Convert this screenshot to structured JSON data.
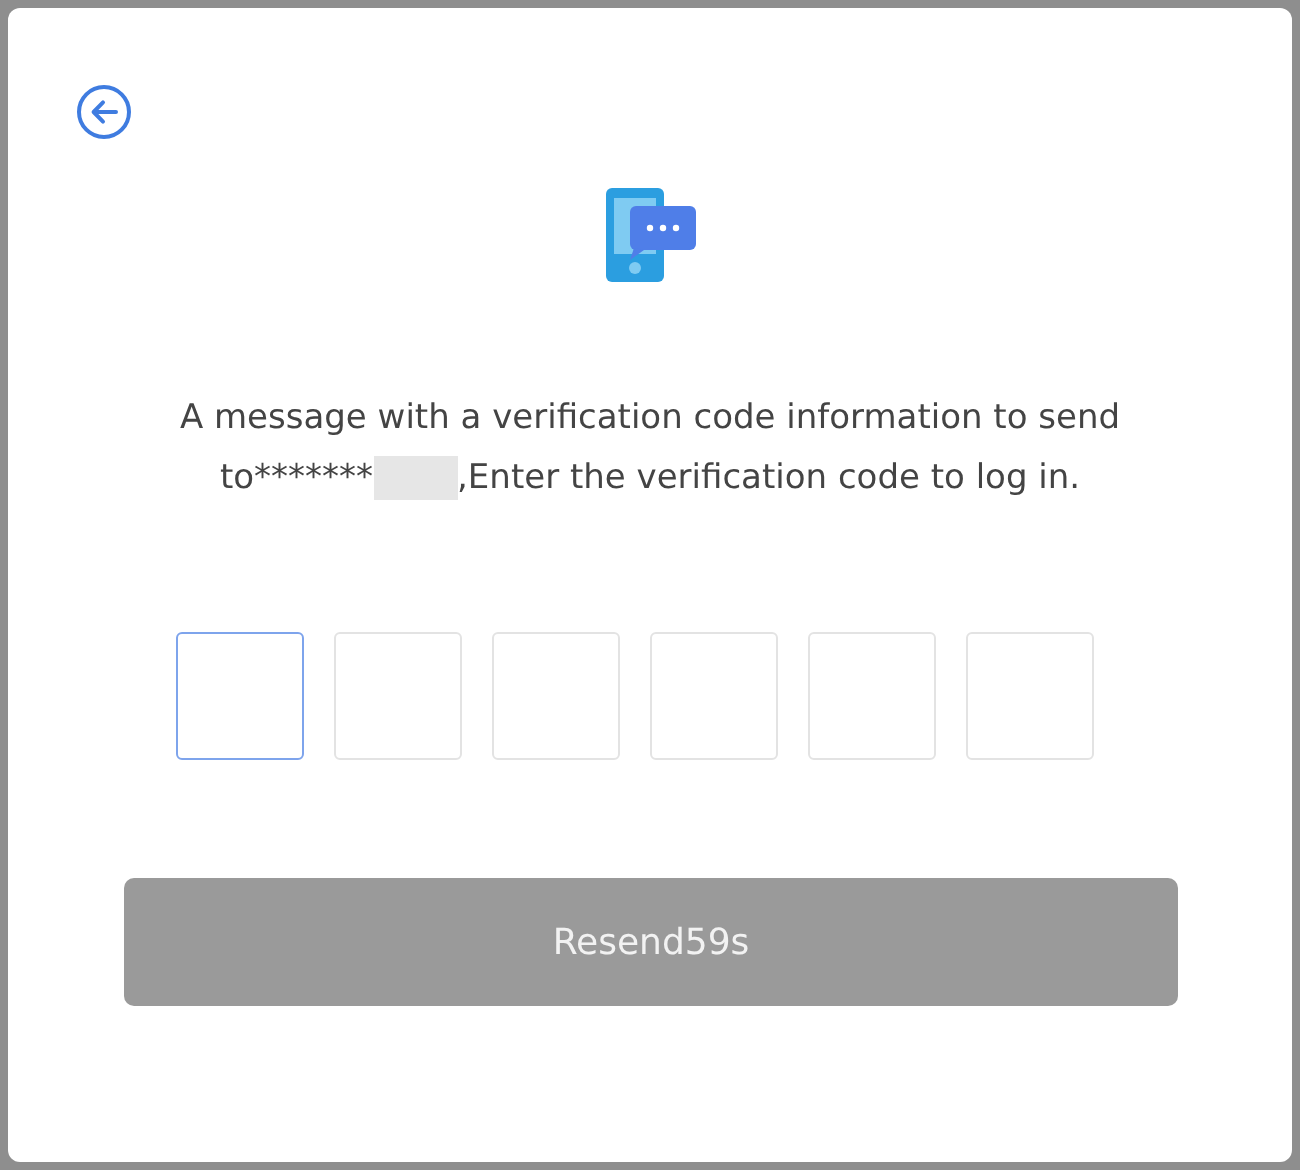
{
  "message": {
    "line_1": "A message with a verification code information to send",
    "line_2_start": "to*******",
    "line_2_redacted": true,
    "line_2_end": ",Enter the verification code to log in."
  },
  "code_boxes": [
    {
      "focused": true
    },
    {
      "focused": false
    },
    {
      "focused": false
    },
    {
      "focused": false
    },
    {
      "focused": false
    },
    {
      "focused": false
    }
  ],
  "resend_button": {
    "label": "Resend59s",
    "disabled": true
  }
}
